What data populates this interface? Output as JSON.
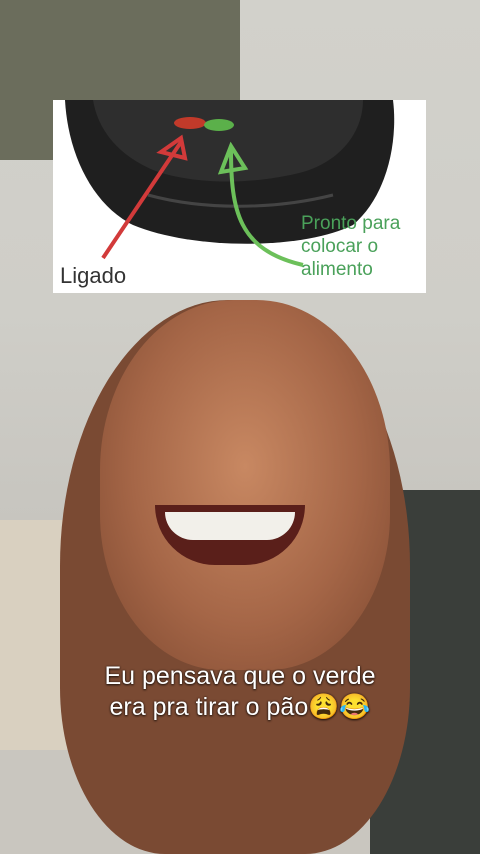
{
  "inset": {
    "label_on": "Ligado",
    "label_ready": [
      "Pronto para",
      "colocar o",
      "alimento"
    ]
  },
  "caption": {
    "line1": "Eu pensava que o verde",
    "line2": "era pra tirar o pão😩😂"
  },
  "colors": {
    "red_arrow": "#d23a3a",
    "green_arrow": "#6cc05a",
    "caption_text": "#ffffff"
  }
}
